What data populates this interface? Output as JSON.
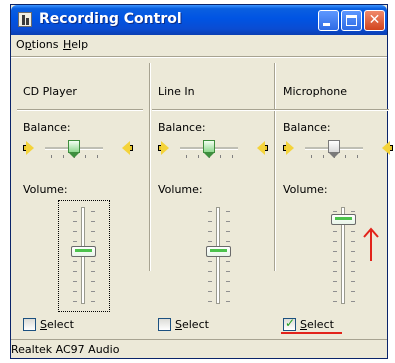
{
  "window": {
    "title": "Recording Control",
    "icon": "speaker-app-icon"
  },
  "titlebar_buttons": [
    "minimize",
    "maximize",
    "close"
  ],
  "close_glyph": "✕",
  "menu": [
    {
      "label": "Options",
      "mnemonic": "p"
    },
    {
      "label": "Help",
      "mnemonic": "H"
    }
  ],
  "panels": [
    {
      "name": "CD Player",
      "balance_label": "Balance:",
      "volume_label": "Volume:",
      "select_label": "Select",
      "select_checked": false,
      "balance_value": 0.5,
      "volume_value": 0.55,
      "focused": true
    },
    {
      "name": "Line In",
      "balance_label": "Balance:",
      "volume_label": "Volume:",
      "select_label": "Select",
      "select_checked": false,
      "balance_value": 0.5,
      "volume_value": 0.55,
      "focused": false
    },
    {
      "name": "Microphone",
      "balance_label": "Balance:",
      "volume_label": "Volume:",
      "select_label": "Select",
      "select_checked": true,
      "balance_value": 0.5,
      "volume_value": 0.92,
      "focused": false
    }
  ],
  "status": {
    "text": "Realtek AC97 Audio"
  },
  "annotations": {
    "color": "#E2231A"
  },
  "colors": {
    "title_blue": "#0054E3",
    "window_bg": "#ECE9D8",
    "close_red": "#D2441E",
    "check_green": "#21A121"
  }
}
